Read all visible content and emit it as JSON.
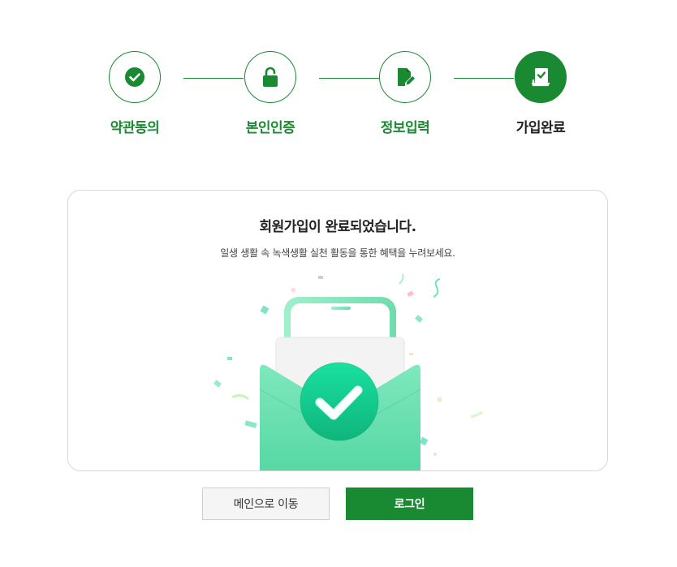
{
  "steps": [
    {
      "label": "약관동의",
      "icon": "check-icon",
      "state": "done"
    },
    {
      "label": "본인인증",
      "icon": "unlock-icon",
      "state": "done"
    },
    {
      "label": "정보입력",
      "icon": "edit-document-icon",
      "state": "done"
    },
    {
      "label": "가입완료",
      "icon": "completed-book-icon",
      "state": "active"
    }
  ],
  "card": {
    "title": "회원가입이 완료되었습니다.",
    "subtitle": "일생 생활 속 녹색생활 실천 활동을 통한 혜택을 누려보세요.",
    "illustration": "phone-envelope-check-icon"
  },
  "buttons": {
    "main_label": "메인으로 이동",
    "login_label": "로그인"
  },
  "colors": {
    "accent": "#1a8a32",
    "mint": "#5ed9a8"
  }
}
